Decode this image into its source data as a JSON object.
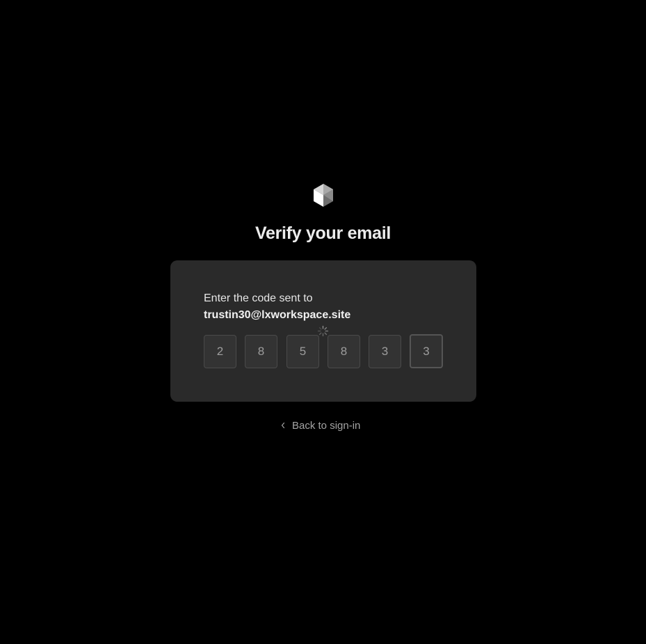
{
  "header": {
    "logo_icon": "cube-logo-icon",
    "title": "Verify your email"
  },
  "card": {
    "instruction": "Enter the code sent to",
    "email": "trustin30@lxworkspace.site",
    "loading_icon": "spinner-icon",
    "code_digits": [
      "2",
      "8",
      "5",
      "8",
      "3",
      "3"
    ]
  },
  "footer": {
    "back_icon": "chevron-left-icon",
    "back_label": "Back to sign-in"
  },
  "colors": {
    "background": "#000000",
    "card": "#2a2a2a",
    "text": "#ececec",
    "muted": "#a3a3a3"
  }
}
